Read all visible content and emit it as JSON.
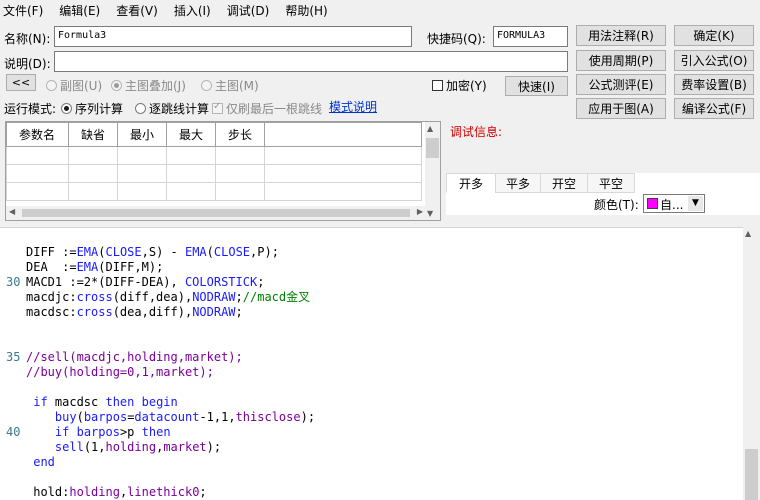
{
  "menu": [
    "文件(F)",
    "编辑(E)",
    "查看(V)",
    "插入(I)",
    "调试(D)",
    "帮助(H)"
  ],
  "form": {
    "name_label": "名称(N):",
    "name_value": "Formula3",
    "shortcut_label": "快捷码(Q):",
    "shortcut_value": "FORMULA3",
    "desc_label": "说明(D):",
    "desc_value": ""
  },
  "buttons": {
    "usage": "用法注释(R)",
    "ok": "确定(K)",
    "period": "使用周期(P)",
    "import": "引入公式(O)",
    "evaluate": "公式测评(E)",
    "fee": "费率设置(B)",
    "apply": "应用于图(A)",
    "compile": "编译公式(F)",
    "fast": "快速(I)",
    "back": "<<"
  },
  "chart_mode": {
    "sub": "副图(U)",
    "main_overlay": "主图叠加(J)",
    "main": "主图(M)",
    "encrypt": "加密(Y)"
  },
  "run_mode": {
    "label": "运行模式:",
    "sequence": "序列计算",
    "tick": "逐跳线计算",
    "last_bar_only": "仅刷最后一根跳线",
    "model_help": "模式说明"
  },
  "params_table": {
    "headers": [
      "参数名",
      "缺省",
      "最小",
      "最大",
      "步长"
    ],
    "rows": 3
  },
  "debug": {
    "label": "调试信息:",
    "tabs": [
      "开多",
      "平多",
      "开空",
      "平空"
    ],
    "color_label": "颜色(T):",
    "color_value": "自...",
    "color_swatch": "#ff00ff"
  },
  "code": {
    "lines": [
      {
        "num": "",
        "text": ""
      },
      {
        "num": "",
        "text": "DIFF :=EMA(CLOSE,S) - EMA(CLOSE,P);"
      },
      {
        "num": "",
        "text": "DEA  :=EMA(DIFF,M);"
      },
      {
        "num": "30",
        "text": "MACD1 :=2*(DIFF-DEA), COLORSTICK;"
      },
      {
        "num": "",
        "text": "macdjc:cross(diff,dea),NODRAW;//macd金叉"
      },
      {
        "num": "",
        "text": "macdsc:cross(dea,diff),NODRAW;"
      },
      {
        "num": "",
        "text": ""
      },
      {
        "num": "",
        "text": ""
      },
      {
        "num": "35",
        "text": "//sell(macdjc,holding,market);"
      },
      {
        "num": "",
        "text": "//buy(holding=0,1,market);"
      },
      {
        "num": "",
        "text": ""
      },
      {
        "num": "",
        "text": " if macdsc then begin"
      },
      {
        "num": "",
        "text": "    buy(barpos=datacount-1,1,thisclose);"
      },
      {
        "num": "40",
        "text": "    if barpos>p then"
      },
      {
        "num": "",
        "text": "    sell(1,holding,market);"
      },
      {
        "num": "",
        "text": " end"
      },
      {
        "num": "",
        "text": ""
      },
      {
        "num": "",
        "text": " hold:holding,linethick0;"
      }
    ]
  }
}
